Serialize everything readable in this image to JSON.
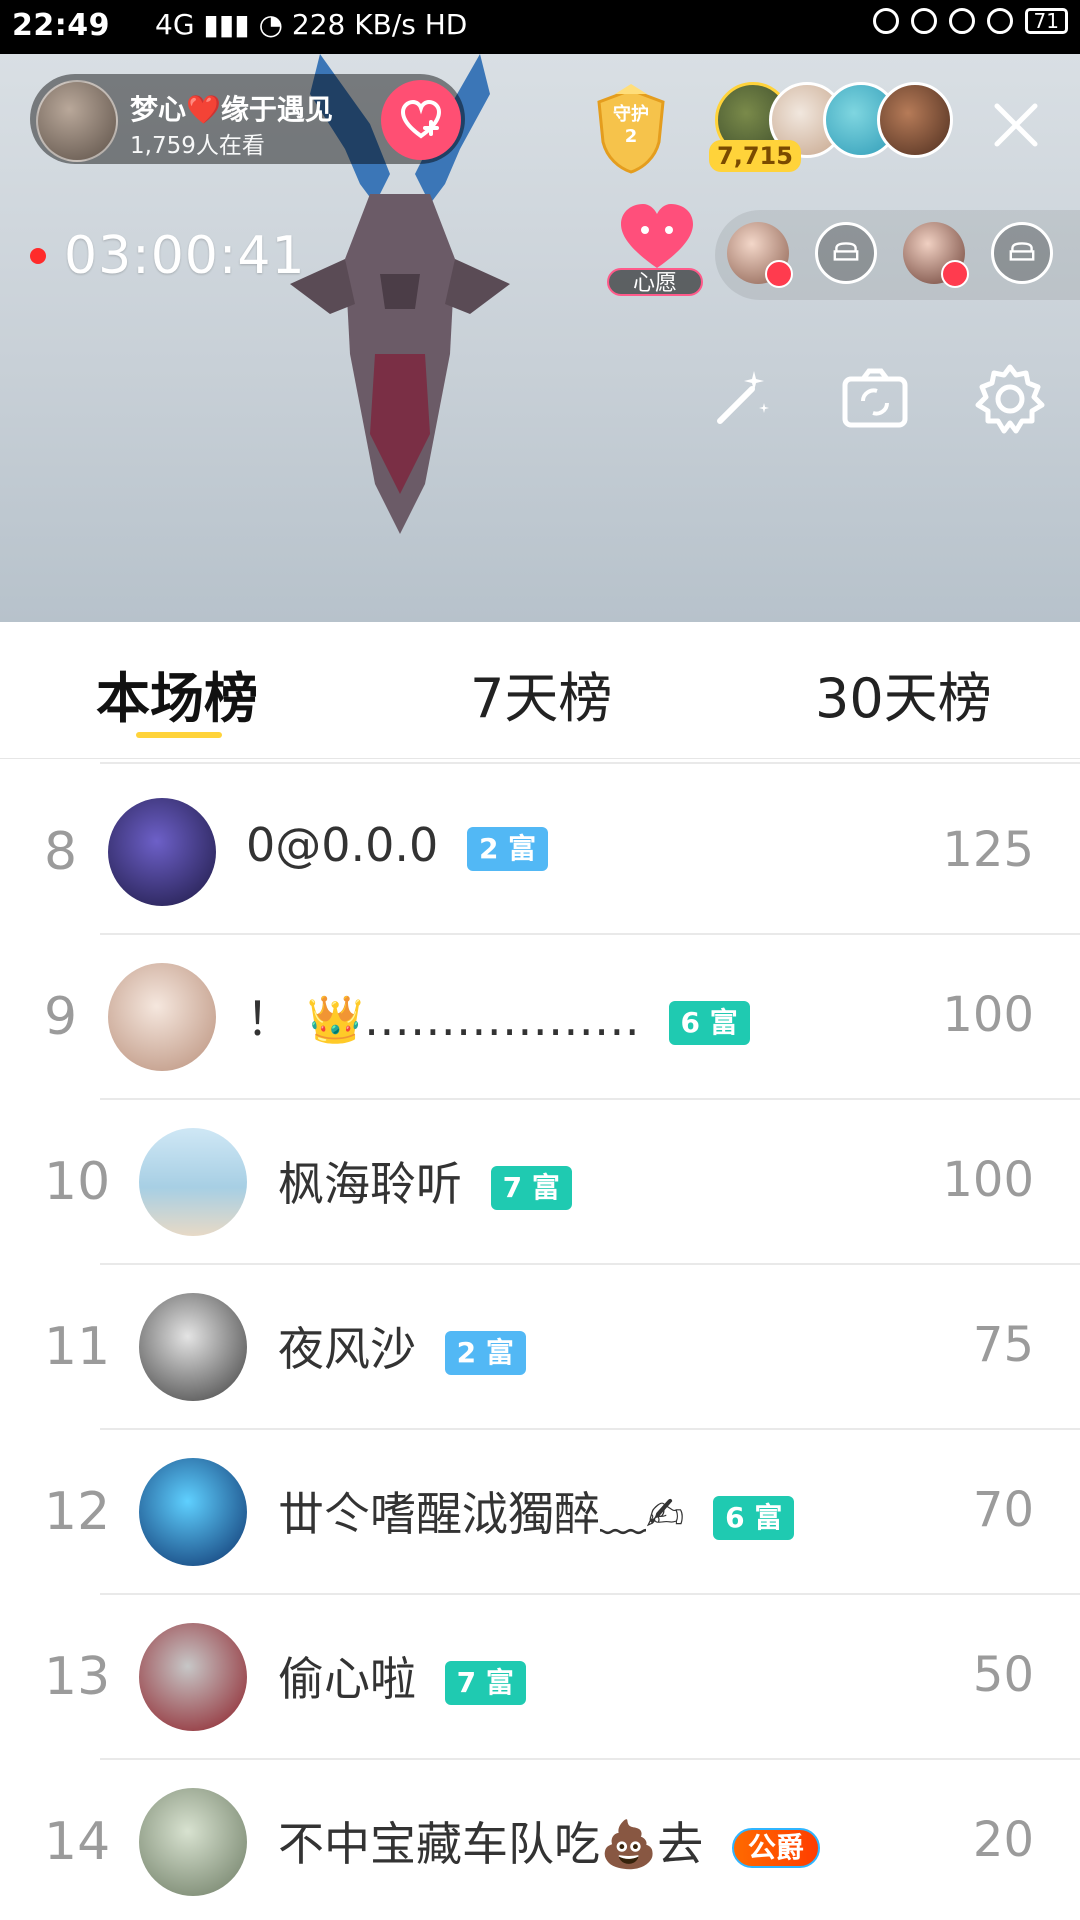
{
  "status_bar": {
    "time": "22:49",
    "net_speed": "228 KB/s",
    "network_label": "4G",
    "hd_label": "HD",
    "battery": "71"
  },
  "live": {
    "host": {
      "name": "梦心❤️缘于遇见",
      "viewers": "1,759人在看"
    },
    "guard_badge": {
      "label": "守护",
      "count": "2"
    },
    "viewer_count_badge": "7,715",
    "timer": "03:00:41",
    "wish_label": "心愿",
    "icons": {
      "follow": "heart-plus-icon",
      "close": "close-icon",
      "magic": "magic-wand-icon",
      "camera_switch": "camera-switch-icon",
      "settings": "gear-icon"
    }
  },
  "tabs": [
    {
      "label": "本场榜",
      "active": true
    },
    {
      "label": "7天榜",
      "active": false
    },
    {
      "label": "30天榜",
      "active": false
    }
  ],
  "leaderboard": [
    {
      "rank": "8",
      "name": "0@0.0.0",
      "badge": "2 富",
      "badge_color": "#52b8f5",
      "score": "125"
    },
    {
      "rank": "9",
      "name": "！ 👑………………",
      "badge": "6 富",
      "badge_color": "#1fcab1",
      "score": "100"
    },
    {
      "rank": "10",
      "name": "枫海聆听",
      "badge": "7 富",
      "badge_color": "#1fcab1",
      "score": "100"
    },
    {
      "rank": "11",
      "name": "夜风沙",
      "badge": "2 富",
      "badge_color": "#52b8f5",
      "score": "75"
    },
    {
      "rank": "12",
      "name": "丗仒嗜醒泧獨醉﹏✍",
      "badge": "6 富",
      "badge_color": "#1fcab1",
      "score": "70"
    },
    {
      "rank": "13",
      "name": "偷心啦",
      "badge": "7 富",
      "badge_color": "#1fcab1",
      "score": "50"
    },
    {
      "rank": "14",
      "name": "不中宝藏车队吃💩去",
      "badge": "公爵",
      "badge_color": "#ff5a00",
      "score": "20"
    }
  ]
}
